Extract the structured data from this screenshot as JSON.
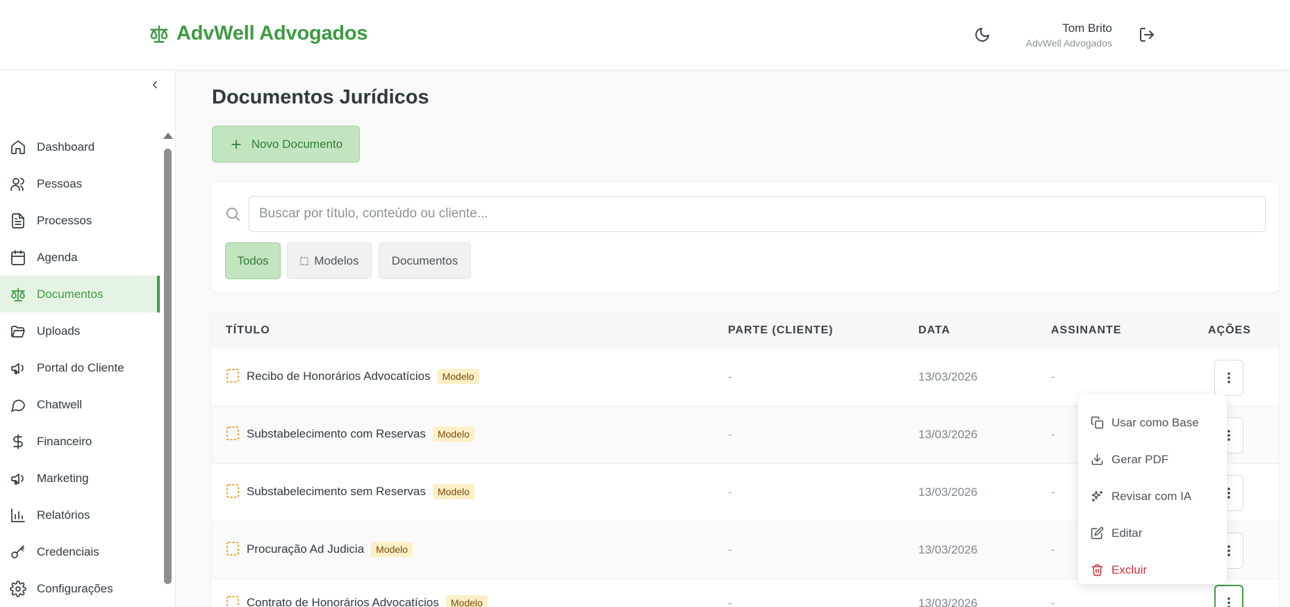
{
  "app": {
    "brand": "AdvWell Advogados"
  },
  "user": {
    "name": "Tom Brito",
    "org": "AdvWell Advogados"
  },
  "sidebar": {
    "items": [
      {
        "label": "Dashboard",
        "icon": "home-icon"
      },
      {
        "label": "Pessoas",
        "icon": "users-icon"
      },
      {
        "label": "Processos",
        "icon": "file-text-icon"
      },
      {
        "label": "Agenda",
        "icon": "calendar-icon"
      },
      {
        "label": "Documentos",
        "icon": "scale-icon",
        "active": true
      },
      {
        "label": "Uploads",
        "icon": "folder-open-icon"
      },
      {
        "label": "Portal do Cliente",
        "icon": "megaphone-icon"
      },
      {
        "label": "Chatwell",
        "icon": "chat-bubble-icon"
      },
      {
        "label": "Financeiro",
        "icon": "dollar-icon"
      },
      {
        "label": "Marketing",
        "icon": "megaphone-icon"
      },
      {
        "label": "Relatórios",
        "icon": "bar-chart-icon"
      },
      {
        "label": "Credenciais",
        "icon": "key-icon"
      },
      {
        "label": "Configurações",
        "icon": "gear-icon"
      }
    ]
  },
  "main": {
    "title": "Documentos Jurídicos",
    "new_button": "Novo Documento",
    "search": {
      "placeholder": "Buscar por título, conteúdo ou cliente...",
      "value": ""
    },
    "filters": {
      "all": "Todos",
      "models": "Modelos",
      "documents": "Documentos",
      "selected": "Todos"
    }
  },
  "table": {
    "headers": {
      "title": "TÍTULO",
      "party": "PARTE (CLIENTE)",
      "date": "DATA",
      "signer": "ASSINANTE",
      "actions": "AÇÕES"
    },
    "rows": [
      {
        "title": "Recibo de Honorários Advocatícios",
        "badge": "Modelo",
        "party": "-",
        "date": "13/03/2026",
        "signer": "-"
      },
      {
        "title": "Substabelecimento com Reservas",
        "badge": "Modelo",
        "party": "-",
        "date": "13/03/2026",
        "signer": "-"
      },
      {
        "title": "Substabelecimento sem Reservas",
        "badge": "Modelo",
        "party": "-",
        "date": "13/03/2026",
        "signer": "-"
      },
      {
        "title": "Procuração Ad Judicia",
        "badge": "Modelo",
        "party": "-",
        "date": "13/03/2026",
        "signer": "-"
      },
      {
        "title": "Contrato de Honorários Advocatícios",
        "badge": "Modelo",
        "party": "-",
        "date": "13/03/2026",
        "signer": "-"
      }
    ]
  },
  "menu": {
    "items": [
      {
        "label": "Usar como Base",
        "icon": "copy-icon"
      },
      {
        "label": "Gerar PDF",
        "icon": "download-icon"
      },
      {
        "label": "Revisar com IA",
        "icon": "sparkles-icon"
      },
      {
        "label": "Editar",
        "icon": "edit-icon"
      },
      {
        "label": "Excluir",
        "icon": "trash-icon"
      }
    ]
  },
  "colors": {
    "accent": "#3f9a44",
    "accent_light": "#c2e5c0",
    "badge_bg": "#fdf0c6",
    "danger": "#d0303a"
  }
}
